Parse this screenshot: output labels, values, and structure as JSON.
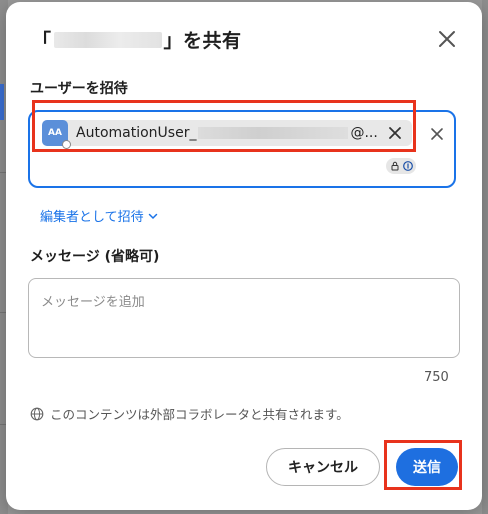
{
  "dialog": {
    "title_prefix": "「",
    "title_suffix": "」を共有",
    "close_icon": "close-icon"
  },
  "invite": {
    "label": "ユーザーを招待",
    "chip": {
      "avatar_initials": "AA",
      "name_prefix": "AutomationUser_",
      "name_suffix": "@..."
    },
    "role_link": "編集者として招待"
  },
  "message": {
    "label": "メッセージ (省略可)",
    "placeholder": "メッセージを追加",
    "char_limit": "750"
  },
  "notice": "このコンテンツは外部コラボレータと共有されます。",
  "buttons": {
    "cancel": "キャンセル",
    "send": "送信"
  },
  "colors": {
    "accent": "#1e6fe0",
    "highlight": "#e8331c"
  }
}
